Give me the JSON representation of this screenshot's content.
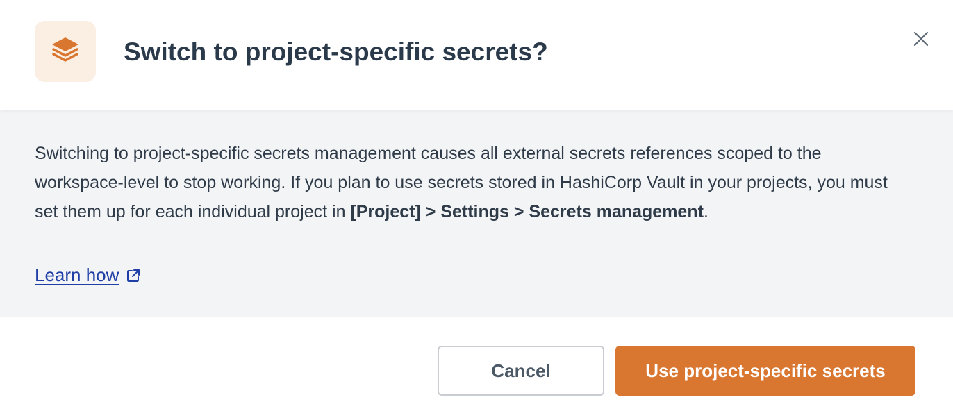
{
  "dialog": {
    "title": "Switch to project-specific secrets?",
    "header_icon": "layers-icon",
    "close_icon": "close-icon"
  },
  "body": {
    "text_part1": "Switching to project-specific secrets management causes all external secrets references scoped to the workspace-level to stop working. If you plan to use secrets stored in HashiCorp Vault in your projects, you must set them up for each individual project in ",
    "path_bold": "[Project] > Settings > Secrets management",
    "text_part2": ".",
    "learn_link": "Learn how",
    "learn_link_icon": "external-link-icon"
  },
  "footer": {
    "cancel_label": "Cancel",
    "confirm_label": "Use project-specific secrets"
  },
  "colors": {
    "accent": "#d97630",
    "icon_bg": "#fbeee2",
    "body_bg": "#f3f4f6",
    "link": "#1f3fa6",
    "text": "#2b3a4a"
  }
}
